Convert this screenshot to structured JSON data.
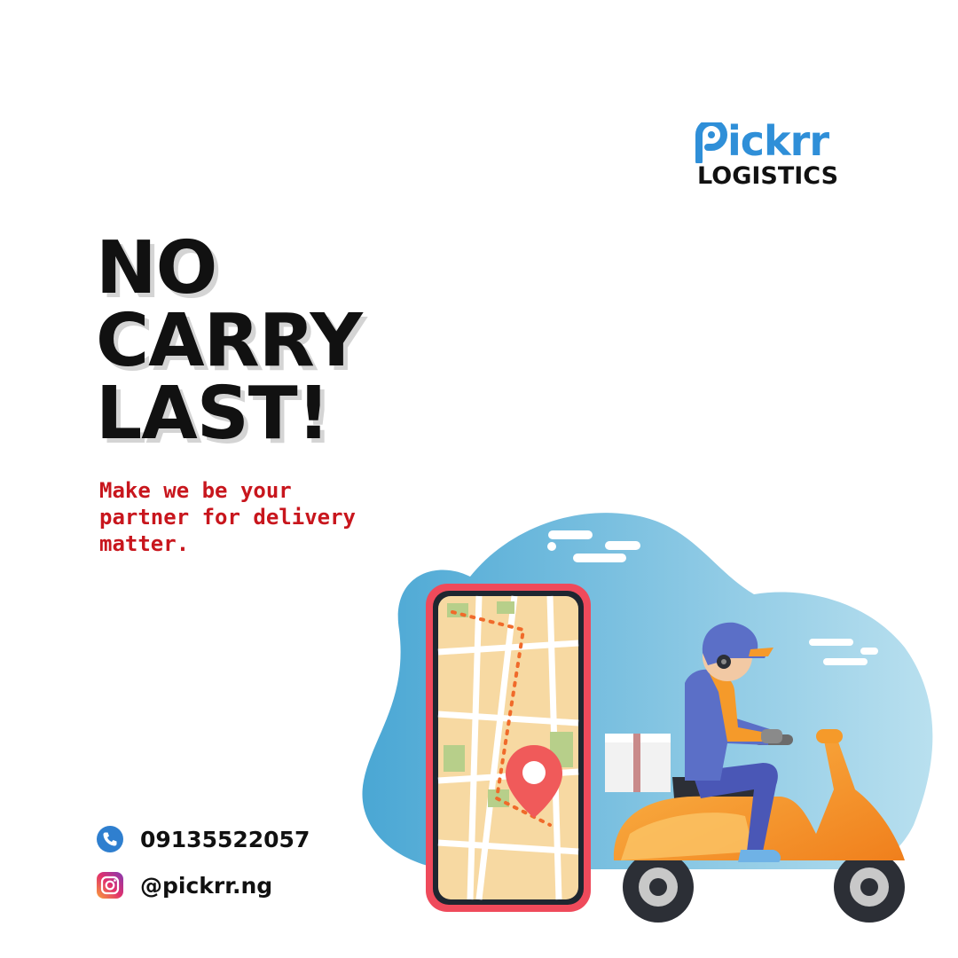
{
  "brand": {
    "name": "Pickrr",
    "wordmark": "ickrr",
    "subtitle": "LOGISTICS",
    "color": "#2f8fd8"
  },
  "headline": {
    "lines": [
      "NO",
      "CARRY",
      "LAST!"
    ]
  },
  "tagline": {
    "lines": [
      "Make we be your",
      "partner for delivery",
      "matter."
    ],
    "color": "#c8161d"
  },
  "contacts": {
    "phone": {
      "icon": "phone-icon",
      "value": "09135522057"
    },
    "instagram": {
      "icon": "instagram-icon",
      "value": "@pickrr.ng"
    }
  },
  "illustration": {
    "subject": "delivery-scooter-rider-with-map-phone",
    "colors": {
      "blob": "#7cc0e0",
      "phone_frame": "#ef4a5b",
      "map": "#f7d9a2",
      "scooter": "#f59a2a",
      "rider_jacket": "#5b6fc7",
      "pin": "#f05a5a"
    }
  }
}
